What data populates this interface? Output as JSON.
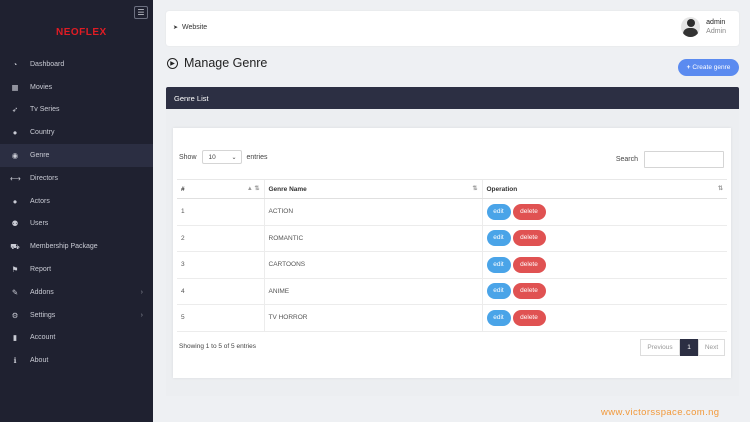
{
  "sidebar": {
    "logo": "NEOFLEX",
    "toggle_icon": "bars-icon",
    "items": [
      {
        "label": "Dashboard",
        "icon": "tachometer-icon",
        "glyph": "◔"
      },
      {
        "label": "Movies",
        "icon": "film-icon",
        "glyph": "▦"
      },
      {
        "label": "Tv Series",
        "icon": "rocket-icon",
        "glyph": "➶"
      },
      {
        "label": "Country",
        "icon": "globe-icon",
        "glyph": "●"
      },
      {
        "label": "Genre",
        "icon": "life-ring-icon",
        "glyph": "◉",
        "active": true
      },
      {
        "label": "Directors",
        "icon": "arrows-icon",
        "glyph": "⟷"
      },
      {
        "label": "Actors",
        "icon": "user-icon",
        "glyph": "●"
      },
      {
        "label": "Users",
        "icon": "users-icon",
        "glyph": "⚉"
      },
      {
        "label": "Membership Package",
        "icon": "cart-icon",
        "glyph": "⛟"
      },
      {
        "label": "Report",
        "icon": "flag-icon",
        "glyph": "⚑"
      },
      {
        "label": "Addons",
        "icon": "plug-icon",
        "glyph": "✎",
        "has_arrow": true
      },
      {
        "label": "Settings",
        "icon": "gear-icon",
        "glyph": "⚙",
        "has_arrow": true
      },
      {
        "label": "Account",
        "icon": "lock-icon",
        "glyph": "▮"
      },
      {
        "label": "About",
        "icon": "info-icon",
        "glyph": "ℹ"
      }
    ]
  },
  "topbar": {
    "website_label": "Website",
    "user_name": "admin",
    "user_role": "Admin"
  },
  "page": {
    "title": "Manage Genre",
    "create_button": "Create genre"
  },
  "card": {
    "header": "Genre List",
    "show_label": "Show",
    "length_value": "10",
    "entries_label": "entries",
    "search_label": "Search",
    "columns": [
      "#",
      "Genre Name",
      "Operation"
    ],
    "edit_label": "edit",
    "delete_label": "delete",
    "rows": [
      {
        "id": "1",
        "name": "ACTION"
      },
      {
        "id": "2",
        "name": "ROMANTIC"
      },
      {
        "id": "3",
        "name": "CARTOONS"
      },
      {
        "id": "4",
        "name": "ANIME"
      },
      {
        "id": "5",
        "name": "TV HORROR"
      }
    ],
    "info": "Showing 1 to 5 of 5 entries",
    "pagination": {
      "previous": "Previous",
      "current": "1",
      "next": "Next"
    }
  },
  "watermark": "www.victorsspace.com.ng"
}
